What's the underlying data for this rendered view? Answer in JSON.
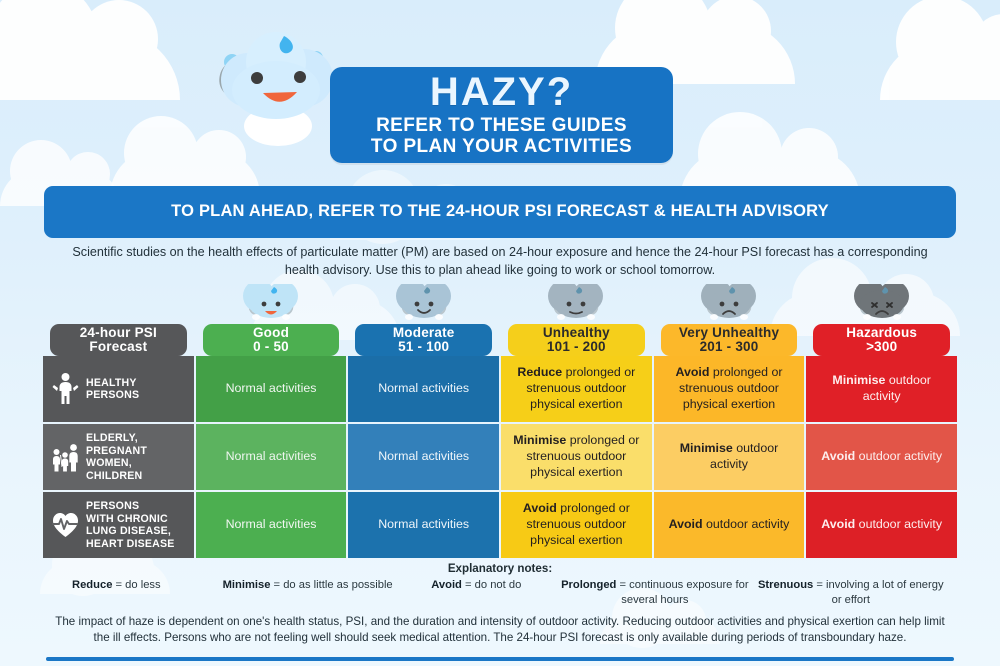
{
  "hero": {
    "title_line1": "HAZY?",
    "title_line2": "REFER TO THESE GUIDES",
    "title_line3": "TO PLAN YOUR ACTIVITIES",
    "mascot_icon": "happy-cloud-mascot-icon",
    "accent_blue": "#1773c4"
  },
  "banner": {
    "text": "TO PLAN AHEAD, REFER TO THE 24-HOUR PSI FORECAST & HEALTH ADVISORY",
    "color": "#1b77c6"
  },
  "intro": "Scientific studies on the health effects of particulate matter (PM) are based on 24-hour exposure and hence the 24-hour PSI forecast has a corresponding health advisory. Use this to plan ahead like going to work or school tomorrow.",
  "table": {
    "corner_header": {
      "line1": "24-hour PSI",
      "line2": "Forecast",
      "color": "#565759"
    },
    "columns": [
      {
        "line1": "Good",
        "line2": "0 - 50",
        "color": "#4caf50",
        "icon": "happy-cloud-icon"
      },
      {
        "line1": "Moderate",
        "line2": "51 - 100",
        "color": "#1a72b0",
        "icon": "smiling-cloud-icon"
      },
      {
        "line1": "Unhealthy",
        "line2": "101 - 200",
        "color": "#f5cf1b",
        "icon": "neutral-cloud-icon"
      },
      {
        "line1": "Very Unhealthy",
        "line2": "201 - 300",
        "color": "#fcb82a",
        "icon": "sad-cloud-icon"
      },
      {
        "line1": "Hazardous",
        "line2": ">300",
        "color": "#e02027",
        "icon": "unhappy-dark-cloud-icon"
      }
    ],
    "rows": [
      {
        "label": "HEALTHY PERSONS",
        "label_lines": [
          "HEALTHY",
          "PERSONS"
        ],
        "icon": "person-flexing-icon",
        "cells": [
          {
            "bold": "",
            "rest": "Normal activities"
          },
          {
            "bold": "",
            "rest": "Normal activities"
          },
          {
            "bold": "Reduce",
            "rest": " prolonged or strenuous outdoor physical exertion"
          },
          {
            "bold": "Avoid",
            "rest": " prolonged or strenuous outdoor physical exertion"
          },
          {
            "bold": "Minimise",
            "rest": " outdoor activity"
          }
        ]
      },
      {
        "label": "ELDERLY, PREGNANT WOMEN, CHILDREN",
        "label_lines": [
          "ELDERLY,",
          "PREGNANT",
          "WOMEN,",
          "CHILDREN"
        ],
        "icon": "family-group-icon",
        "cells": [
          {
            "bold": "",
            "rest": "Normal activities"
          },
          {
            "bold": "",
            "rest": "Normal activities"
          },
          {
            "bold": "Minimise",
            "rest": " prolonged or strenuous outdoor physical exertion"
          },
          {
            "bold": "Minimise",
            "rest": " outdoor activity"
          },
          {
            "bold": "Avoid",
            "rest": " outdoor activity"
          }
        ]
      },
      {
        "label": "PERSONS WITH CHRONIC LUNG DISEASE, HEART DISEASE",
        "label_lines": [
          "PERSONS",
          "WITH CHRONIC",
          "LUNG DISEASE,",
          "HEART DISEASE"
        ],
        "icon": "heart-pulse-icon",
        "cells": [
          {
            "bold": "",
            "rest": "Normal activities"
          },
          {
            "bold": "",
            "rest": "Normal activities"
          },
          {
            "bold": "Avoid",
            "rest": " prolonged or strenuous outdoor physical exertion"
          },
          {
            "bold": "Avoid",
            "rest": " outdoor activity"
          },
          {
            "bold": "Avoid",
            "rest": " outdoor activity"
          }
        ]
      }
    ]
  },
  "notes": {
    "title": "Explanatory notes:",
    "items": [
      {
        "term": "Reduce",
        "definition": " = do less"
      },
      {
        "term": "Minimise",
        "definition": " = do as little as possible"
      },
      {
        "term": "Avoid",
        "definition": " = do not do"
      },
      {
        "term": "Prolonged",
        "definition": " = continuous exposure for several hours"
      },
      {
        "term": "Strenuous",
        "definition": " = involving a lot of energy or effort"
      }
    ]
  },
  "footer": "The impact of haze is dependent on one's health status, PSI, and the duration and intensity of outdoor activity. Reducing outdoor activities and physical exertion can help limit the ill effects. Persons who are not feeling well should seek medical attention. The 24-hour PSI forecast is only available during periods of transboundary haze."
}
